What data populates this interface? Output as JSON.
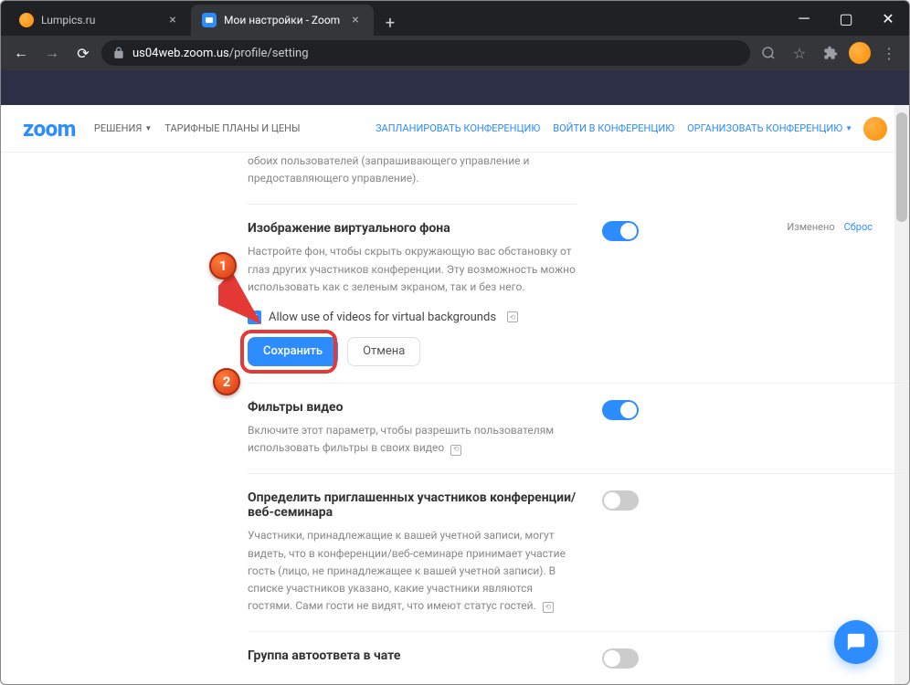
{
  "browser": {
    "tabs": [
      {
        "title": "Lumpics.ru"
      },
      {
        "title": "Мои настройки - Zoom"
      }
    ],
    "url_domain": "us04web.zoom.us",
    "url_path": "/profile/setting"
  },
  "header": {
    "logo": "zoom",
    "nav": {
      "solutions": "РЕШЕНИЯ",
      "pricing": "ТАРИФНЫЕ ПЛАНЫ И ЦЕНЫ",
      "schedule": "ЗАПЛАНИРОВАТЬ КОНФЕРЕНЦИЮ",
      "join": "ВОЙТИ В КОНФЕРЕНЦИЮ",
      "host": "ОРГАНИЗОВАТЬ КОНФЕРЕНЦИЮ"
    }
  },
  "settings": {
    "remote_tail": "обоих пользователей (запрашивающего управление и предоставляющего управление).",
    "vbg": {
      "title": "Изображение виртуального фона",
      "desc": "Настройте фон, чтобы скрыть окружающую вас обстановку от глаз других участников конференции. Эту возможность можно использовать как с зеленым экраном, так и без него.",
      "checkbox": "Allow use of videos for virtual backgrounds",
      "save": "Сохранить",
      "cancel": "Отмена",
      "changed": "Изменено",
      "reset": "Сброс"
    },
    "filters": {
      "title": "Фильтры видео",
      "desc": "Включите этот параметр, чтобы разрешить пользователям использовать фильтры в своих видео"
    },
    "guests": {
      "title": "Определить приглашенных участников конференции/веб-семинара",
      "desc": "Участники, принадлежащие к вашей учетной записи, могут видеть, что в конференции/веб-семинаре принимает участие гость (лицо, не принадлежащее к вашей учетной записи). В списке участников указано, какие участники являются гостями. Сами гости не видят, что имеют статус гостей."
    },
    "autoreply": {
      "title": "Группа автоответа в чате"
    }
  },
  "markers": {
    "one": "1",
    "two": "2"
  }
}
